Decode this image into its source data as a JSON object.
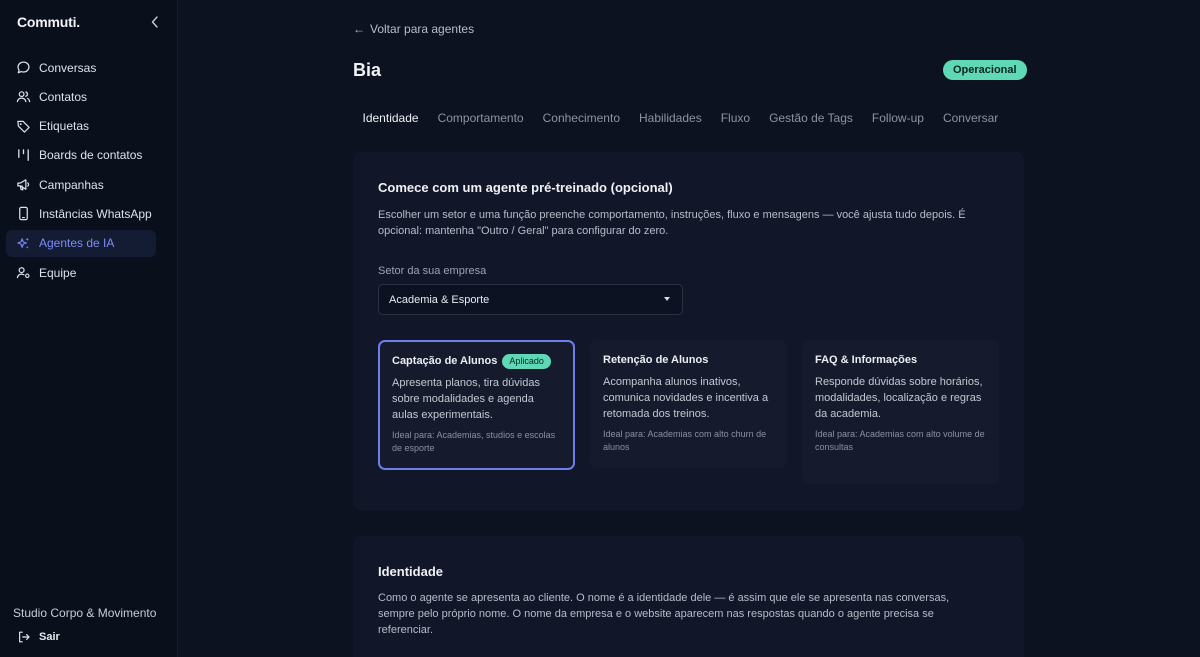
{
  "app": {
    "brand": "Commuti."
  },
  "sidebar": {
    "items": [
      {
        "label": "Conversas",
        "icon": "chat-bubble-icon",
        "active": false
      },
      {
        "label": "Contatos",
        "icon": "users-icon",
        "active": false
      },
      {
        "label": "Etiquetas",
        "icon": "tag-icon",
        "active": false
      },
      {
        "label": "Boards de contatos",
        "icon": "kanban-icon",
        "active": false
      },
      {
        "label": "Campanhas",
        "icon": "megaphone-icon",
        "active": false
      },
      {
        "label": "Instâncias WhatsApp",
        "icon": "phone-icon",
        "active": false
      },
      {
        "label": "Agentes de IA",
        "icon": "sparkles-icon",
        "active": true
      },
      {
        "label": "Equipe",
        "icon": "user-settings-icon",
        "active": false
      }
    ],
    "org_name": "Studio Corpo & Movimento",
    "logout_label": "Sair"
  },
  "header": {
    "back_label": "Voltar para agentes",
    "agent_name": "Bia",
    "status": "Operacional"
  },
  "tabs": [
    {
      "label": "Identidade",
      "active": true
    },
    {
      "label": "Comportamento",
      "active": false
    },
    {
      "label": "Conhecimento",
      "active": false
    },
    {
      "label": "Habilidades",
      "active": false
    },
    {
      "label": "Fluxo",
      "active": false
    },
    {
      "label": "Gestão de Tags",
      "active": false
    },
    {
      "label": "Follow-up",
      "active": false
    },
    {
      "label": "Conversar",
      "active": false
    }
  ],
  "pretrained": {
    "title": "Comece com um agente pré-treinado (opcional)",
    "description": "Escolher um setor e uma função preenche comportamento, instruções, fluxo e mensagens — você ajusta tudo depois. É opcional: mantenha \"Outro / Geral\" para configurar do zero.",
    "sector_label": "Setor da sua empresa",
    "sector_value": "Academia & Esporte",
    "templates": [
      {
        "name": "Captação de Alunos",
        "badge": "Aplicado",
        "description": "Apresenta planos, tira dúvidas sobre modalidades e agenda aulas experimentais.",
        "ideal": "Ideal para: Academias, studios e escolas de esporte",
        "selected": true
      },
      {
        "name": "Retenção de Alunos",
        "badge": "",
        "description": "Acompanha alunos inativos, comunica novidades e incentiva a retomada dos treinos.",
        "ideal": "Ideal para: Academias com alto churn de alunos",
        "selected": false
      },
      {
        "name": "FAQ & Informações",
        "badge": "",
        "description": "Responde dúvidas sobre horários, modalidades, localização e regras da academia.",
        "ideal": "Ideal para: Academias com alto volume de consultas",
        "selected": false
      }
    ]
  },
  "identity": {
    "title": "Identidade",
    "description": "Como o agente se apresenta ao cliente. O nome é a identidade dele — é assim que ele se apresenta nas conversas, sempre pelo próprio nome. O nome da empresa e o website aparecem nas respostas quando o agente precisa se referenciar."
  },
  "colors": {
    "accent": "#6e7df0",
    "status": "#5fd8b6",
    "background": "#0d1220"
  }
}
